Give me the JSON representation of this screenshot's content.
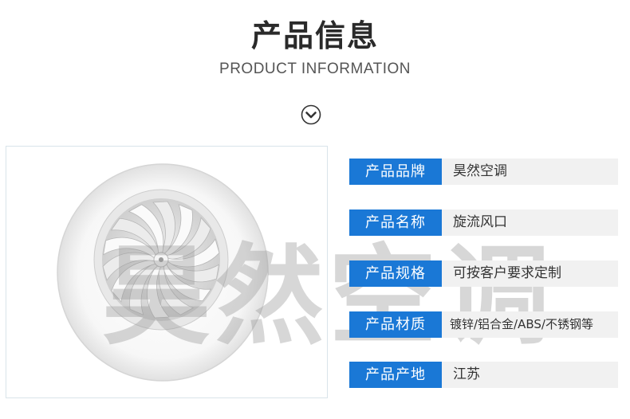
{
  "header": {
    "title": "产品信息",
    "subtitle": "PRODUCT INFORMATION",
    "scroll_icon": "chevron-down-circle-icon"
  },
  "product_image": {
    "description_icon": "round-swirl-air-diffuser",
    "watermark": "昊然空调"
  },
  "specs": [
    {
      "label": "产品品牌",
      "value": "昊然空调"
    },
    {
      "label": "产品名称",
      "value": "旋流风口"
    },
    {
      "label": "产品规格",
      "value": "可按客户要求定制"
    },
    {
      "label": "产品材质",
      "value": "镀锌/铝合金/ABS/不锈钢等"
    },
    {
      "label": "产品产地",
      "value": "江苏"
    }
  ],
  "colors": {
    "label_bg": "#1a78d6",
    "value_bg": "#f1f1f1",
    "photo_border": "#d9e4ea"
  }
}
